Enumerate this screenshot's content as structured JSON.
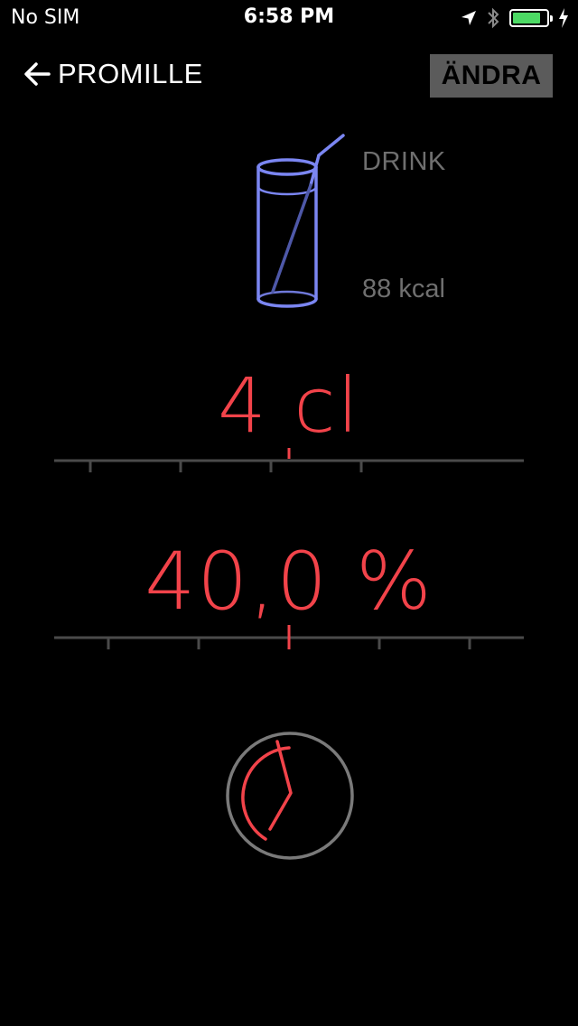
{
  "status_bar": {
    "carrier": "No SIM",
    "time": "6:58 PM",
    "battery_color": "#4cd964"
  },
  "nav": {
    "back_label": "PROMILLE",
    "edit_label": "ÄNDRA"
  },
  "drink": {
    "name": "DRINK",
    "kcal": "88 kcal",
    "icon": "glass-with-straw-icon",
    "icon_color": "#7b86f2"
  },
  "volume": {
    "display": "4 cl"
  },
  "abv": {
    "display": "40,0 %"
  },
  "timer": {
    "icon": "timer-dial-icon"
  },
  "colors": {
    "accent": "#f2434a",
    "muted_text": "#6f6f6f",
    "slider_track": "#4a4a4a",
    "dial_ring": "#7a7a7a"
  }
}
